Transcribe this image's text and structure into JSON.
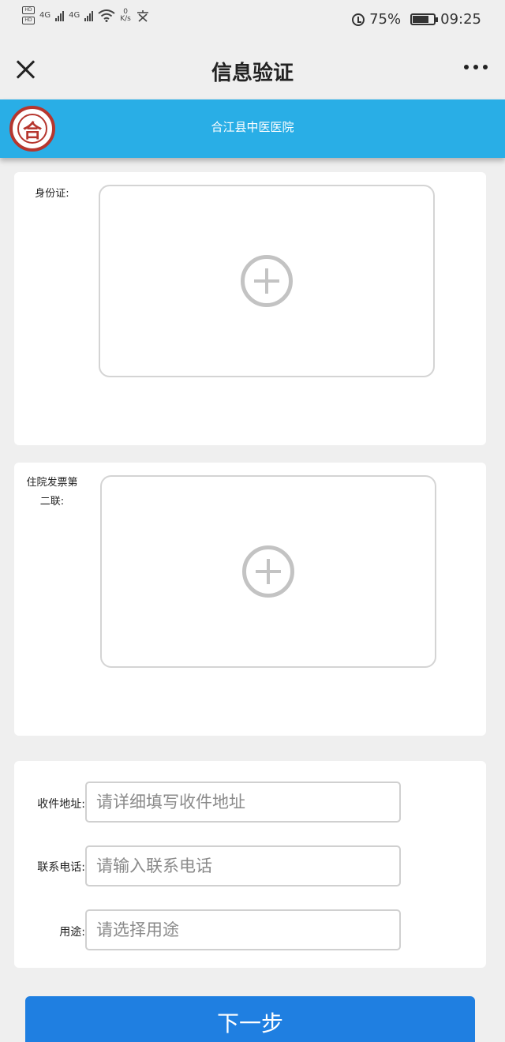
{
  "status_bar": {
    "sim1": "HD",
    "sim2": "HD",
    "net1": "4G",
    "net2": "4G",
    "speed_value": "0",
    "speed_unit": "K/s",
    "battery_percent": "75%",
    "battery_level": 0.75,
    "time": "09:25"
  },
  "title_bar": {
    "title": "信息验证"
  },
  "banner": {
    "hospital_name": "合江县中医医院",
    "logo_glyph": "合",
    "color": "#29aee6"
  },
  "form": {
    "id_card_label": "身份证:",
    "invoice_label_line1": "住院发票第",
    "invoice_label_line2": "二联:",
    "address_label": "收件地址:",
    "address_placeholder": "请详细填写收件地址",
    "phone_label": "联系电话:",
    "phone_placeholder": "请输入联系电话",
    "purpose_label": "用途:",
    "purpose_placeholder": "请选择用途"
  },
  "next_button_label": "下一步",
  "colors": {
    "primary_button": "#1f7fe1",
    "logo_red": "#b6362e"
  }
}
